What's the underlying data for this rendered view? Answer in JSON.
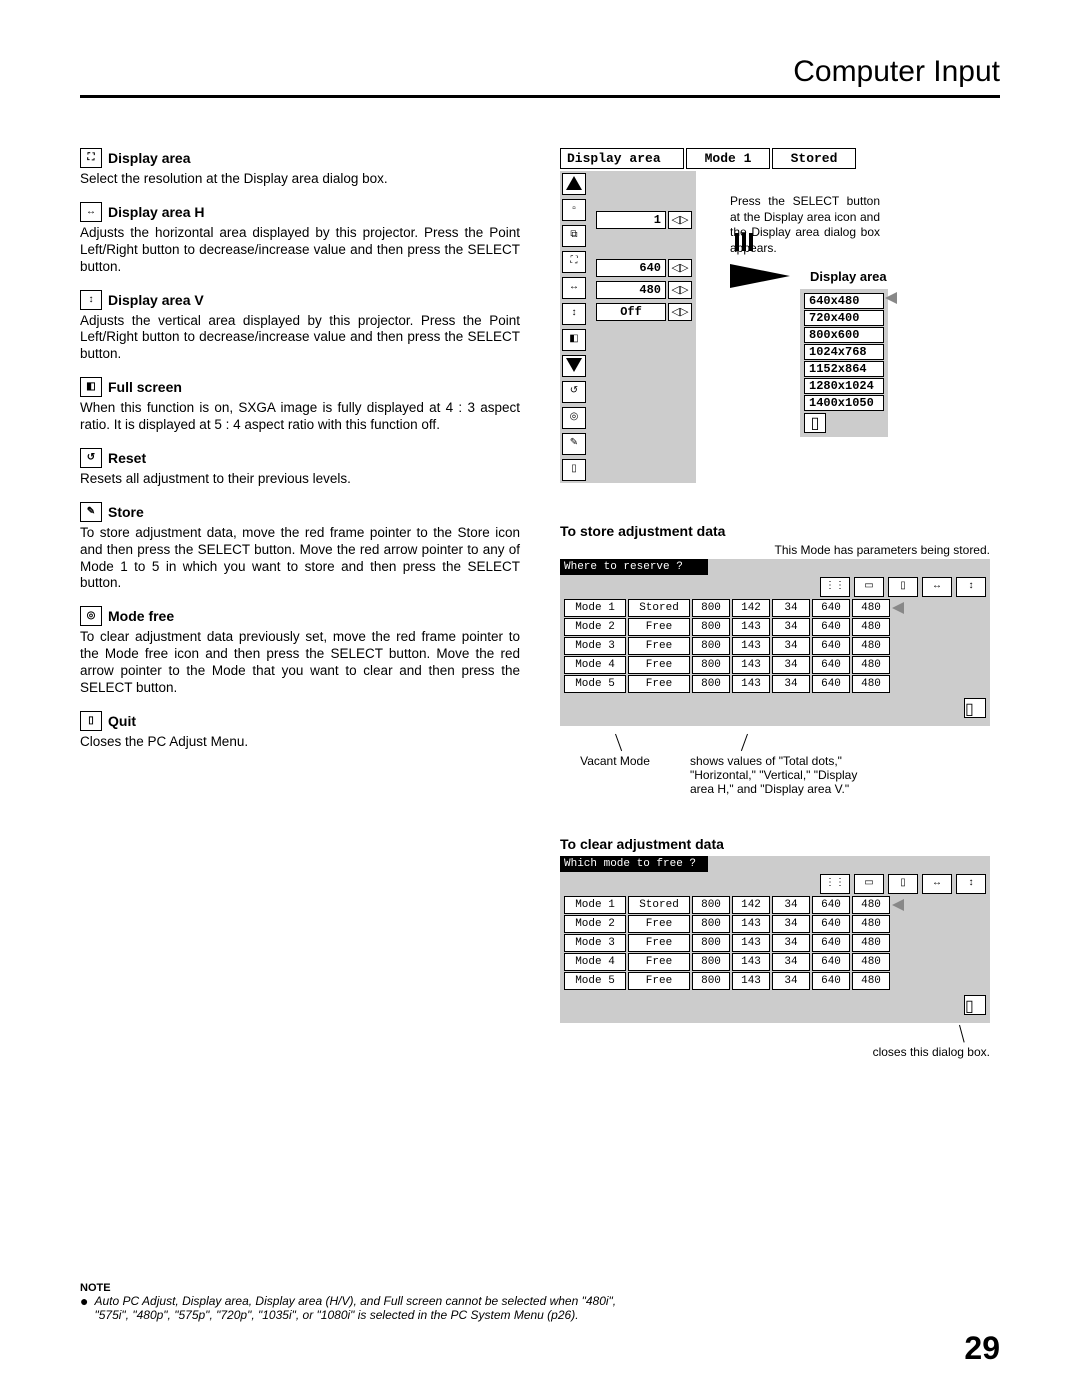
{
  "header": {
    "title": "Computer Input"
  },
  "pagenum": "29",
  "left": {
    "display_area": {
      "title": "Display area",
      "body": "Select the resolution at the Display area dialog box."
    },
    "display_area_h": {
      "title": "Display area H",
      "body": "Adjusts the horizontal area displayed by this projector.  Press the Point Left/Right button to decrease/increase value and then press the SELECT button."
    },
    "display_area_v": {
      "title": "Display area V",
      "body": "Adjusts the vertical area displayed by this projector.  Press the Point Left/Right button to decrease/increase value and then press the SELECT button."
    },
    "full_screen": {
      "title": "Full screen",
      "body": "When this function is on, SXGA image is fully displayed at 4 : 3 aspect ratio.  It is displayed at 5 : 4 aspect ratio with this function off."
    },
    "reset": {
      "title": "Reset",
      "body": "Resets all adjustment to their previous levels."
    },
    "store": {
      "title": "Store",
      "body": "To store adjustment data, move the red frame pointer to the Store icon and then press the SELECT button.  Move the red arrow pointer to any of Mode 1 to 5 in which you want to store  and then press the SELECT button."
    },
    "mode_free": {
      "title": "Mode free",
      "body": "To clear adjustment data previously set, move the red frame pointer to the Mode free icon and then press the SELECT button.  Move the red arrow pointer to the Mode that you want to clear and then press the SELECT button."
    },
    "quit": {
      "title": "Quit",
      "body": "Closes the PC Adjust Menu."
    }
  },
  "osd": {
    "hdr_left": "Display area",
    "hdr_mid": "Mode 1",
    "hdr_right": "Stored",
    "row1": "1",
    "row_h": "640",
    "row_v": "480",
    "row_full": "Off",
    "callout": "Press the SELECT button at the Display area icon and the Display area dialog box appears.",
    "da_label": "Display area",
    "resolutions": [
      "640x480",
      "720x400",
      "800x600",
      "1024x768",
      "1152x864",
      "1280x1024",
      "1400x1050"
    ]
  },
  "store_section": {
    "heading": "To store adjustment data",
    "desc": "This Mode has parameters being stored.",
    "tbl_title": "Where to reserve ?",
    "note_left": "Vacant Mode",
    "note_right": "shows values of \"Total dots,\" \"Horizontal,\" \"Vertical,\" \"Display area H,\" and \"Display area V.\""
  },
  "clear_section": {
    "heading": "To clear adjustment data",
    "tbl_title": "Which mode to free ?",
    "closes": "closes this dialog box."
  },
  "mode_table": {
    "rows": [
      {
        "mode": "Mode 1",
        "stat": "Stored",
        "a": "800",
        "b": "142",
        "c": "34",
        "d": "640",
        "e": "480"
      },
      {
        "mode": "Mode 2",
        "stat": "Free",
        "a": "800",
        "b": "143",
        "c": "34",
        "d": "640",
        "e": "480"
      },
      {
        "mode": "Mode 3",
        "stat": "Free",
        "a": "800",
        "b": "143",
        "c": "34",
        "d": "640",
        "e": "480"
      },
      {
        "mode": "Mode 4",
        "stat": "Free",
        "a": "800",
        "b": "143",
        "c": "34",
        "d": "640",
        "e": "480"
      },
      {
        "mode": "Mode 5",
        "stat": "Free",
        "a": "800",
        "b": "143",
        "c": "34",
        "d": "640",
        "e": "480"
      }
    ]
  },
  "note": {
    "title": "NOTE",
    "body": "Auto PC Adjust, Display area, Display area (H/V), and Full screen cannot be selected when \"480i\", \"575i\", \"480p\", \"575p\", \"720p\", \"1035i\", or \"1080i\" is selected in the PC System Menu (p26)."
  }
}
